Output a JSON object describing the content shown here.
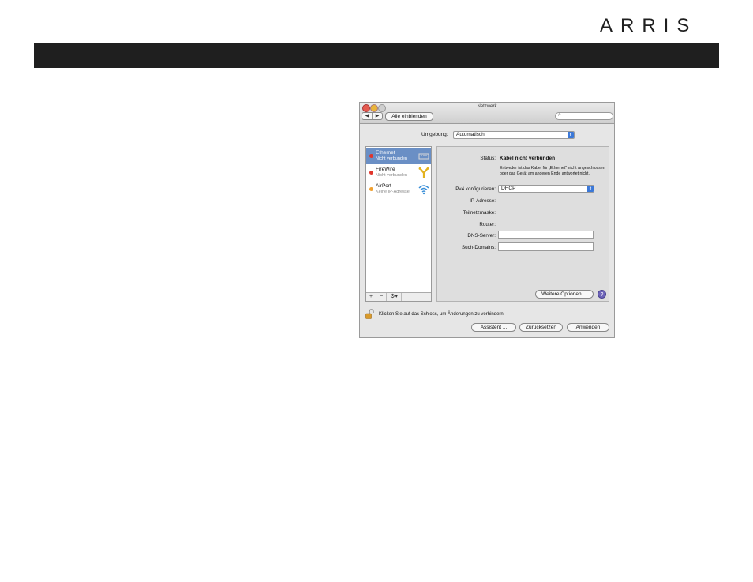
{
  "brand": {
    "logo_text": "ARRIS"
  },
  "window": {
    "title": "Netzwerk",
    "toolbar": {
      "back": "◀",
      "forward": "▶",
      "show_all": "Alle einblenden",
      "search_placeholder": ""
    },
    "location": {
      "label": "Umgebung:",
      "value": "Automatisch"
    },
    "services": [
      {
        "name": "Ethernet",
        "status": "Nicht verbunden",
        "dot_color": "#e0352b",
        "selected": true,
        "icon": "ethernet-icon"
      },
      {
        "name": "FireWire",
        "status": "Nicht verbunden",
        "dot_color": "#e0352b",
        "selected": false,
        "icon": "firewire-icon"
      },
      {
        "name": "AirPort",
        "status": "Keine IP-Adresse",
        "dot_color": "#f0a030",
        "selected": false,
        "icon": "wifi-icon"
      }
    ],
    "service_actions": {
      "add": "+",
      "remove": "−",
      "gear": "⚙▾"
    },
    "detail": {
      "status_label": "Status:",
      "status_value": "Kabel nicht verbunden",
      "status_description": "Entweder ist das Kabel für „Ethernet\" nicht angeschlossen oder das Gerät am anderen Ende antwortet nicht.",
      "ipv4_label": "IPv4 konfigurieren:",
      "ipv4_value": "DHCP",
      "ip_label": "IP-Adresse:",
      "subnet_label": "Teilnetzmaske:",
      "router_label": "Router:",
      "dns_label": "DNS-Server:",
      "dns_value": "",
      "search_domains_label": "Such-Domains:",
      "search_domains_value": "",
      "advanced_button": "Weitere Optionen ...",
      "help": "?"
    },
    "footer": {
      "lock_text": "Klicken Sie auf das Schloss, um Änderungen zu verhindern.",
      "assistant": "Assistent ...",
      "revert": "Zurücksetzen",
      "apply": "Anwenden"
    }
  }
}
